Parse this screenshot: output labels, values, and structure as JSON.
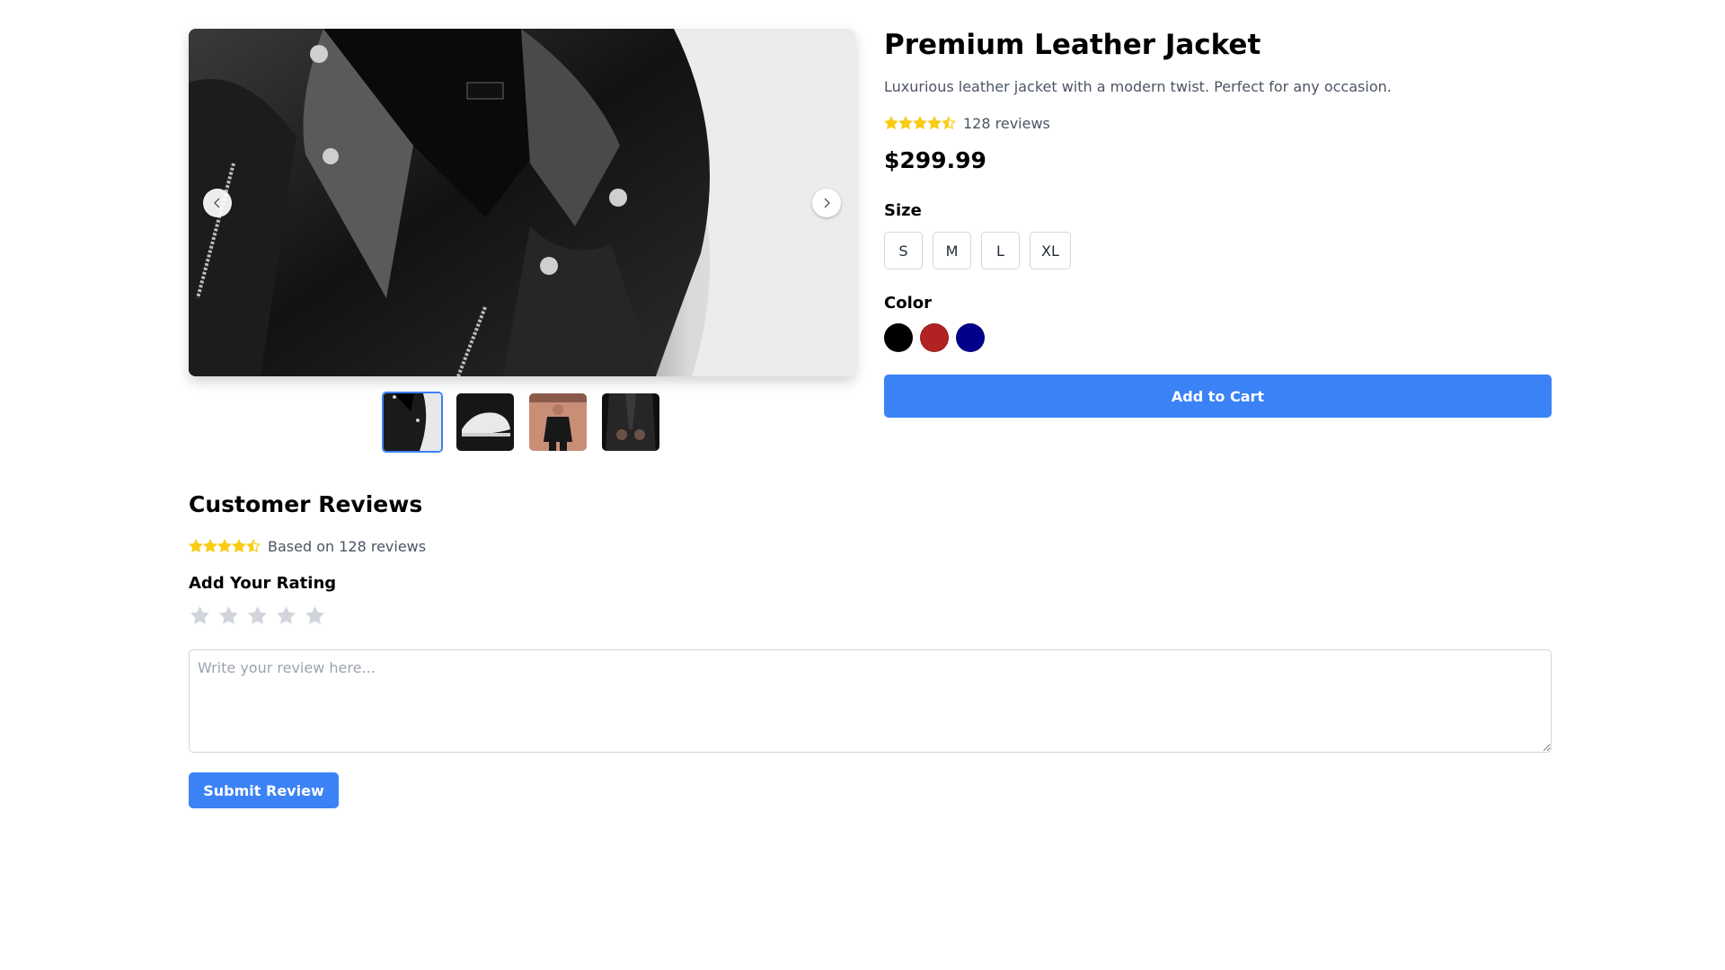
{
  "product": {
    "title": "Premium Leather Jacket",
    "description": "Luxurious leather jacket with a modern twist. Perfect for any occasion.",
    "rating": 4.5,
    "reviews_label": "128 reviews",
    "price": "$299.99"
  },
  "gallery": {
    "active_index": 0,
    "prev_icon": "chevron-left-icon",
    "next_icon": "chevron-right-icon",
    "thumbnails": [
      "leather jacket",
      "white sneakers",
      "person in black outfit",
      "person in leather jacket"
    ]
  },
  "size": {
    "label": "Size",
    "options": [
      "S",
      "M",
      "L",
      "XL"
    ]
  },
  "color": {
    "label": "Color",
    "options": [
      "#000000",
      "#b22222",
      "#00008b"
    ]
  },
  "cart": {
    "button_label": "Add to Cart"
  },
  "reviews": {
    "title": "Customer Reviews",
    "rating": 4.5,
    "summary": "Based on 128 reviews",
    "add_rating_label": "Add Your Rating",
    "user_rating": 0,
    "textarea_placeholder": "Write your review here...",
    "textarea_value": "",
    "submit_label": "Submit Review"
  },
  "colors": {
    "accent": "#3b82f6",
    "star_filled": "#facc15",
    "star_empty": "#d1d5db",
    "muted_text": "#4b5563"
  }
}
